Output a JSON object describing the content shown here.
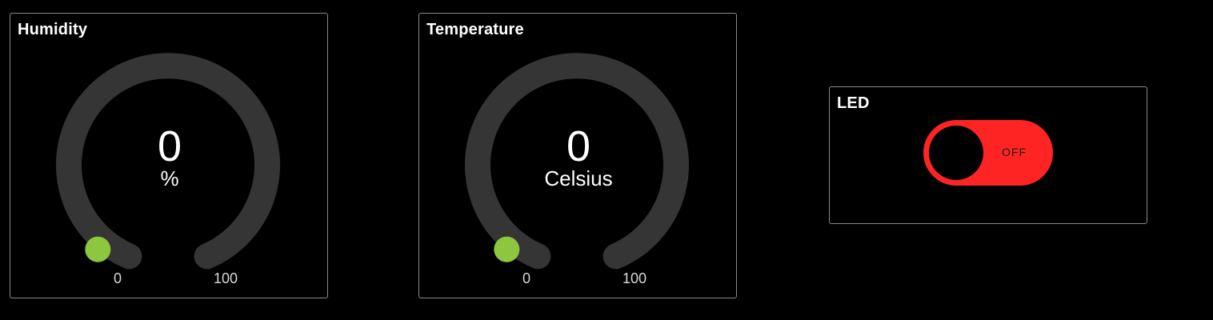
{
  "colors": {
    "background": "#000000",
    "card_border": "#8a8a8a",
    "gauge_track": "#353535",
    "gauge_indicator": "#8dc63f",
    "toggle_off": "#ff2424"
  },
  "widgets": {
    "humidity": {
      "title": "Humidity",
      "value": "0",
      "unit": "%",
      "min": "0",
      "max": "100",
      "level_fraction": 0
    },
    "temperature": {
      "title": "Temperature",
      "value": "0",
      "unit": "Celsius",
      "min": "0",
      "max": "100",
      "level_fraction": 0
    },
    "led": {
      "title": "LED",
      "state_label": "OFF",
      "is_on": false
    }
  }
}
